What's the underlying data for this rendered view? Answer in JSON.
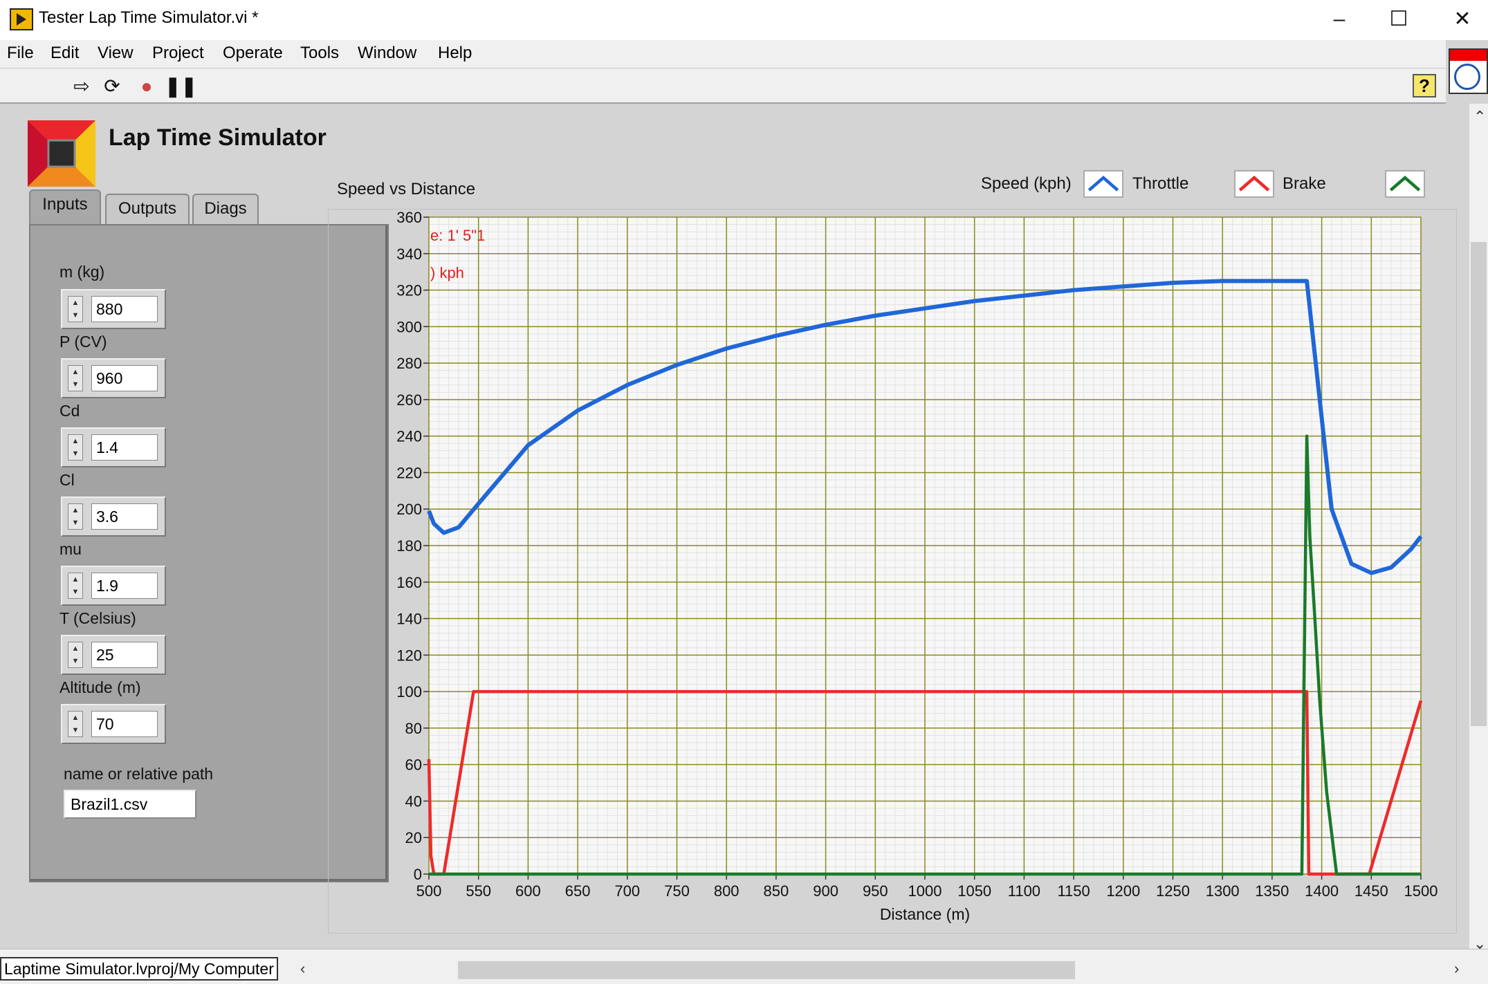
{
  "window": {
    "title": "Tester Lap Time Simulator.vi *"
  },
  "menu": [
    "File",
    "Edit",
    "View",
    "Project",
    "Operate",
    "Tools",
    "Window",
    "Help"
  ],
  "toolbar": {
    "help_label": "?"
  },
  "app": {
    "title": "Lap Time Simulator"
  },
  "tabs": [
    "Inputs",
    "Outputs",
    "Diags"
  ],
  "inputs": [
    {
      "label": "m (kg)",
      "value": "880"
    },
    {
      "label": "P (CV)",
      "value": "960"
    },
    {
      "label": "Cd",
      "value": "1.4"
    },
    {
      "label": "Cl",
      "value": "3.6"
    },
    {
      "label": "mu",
      "value": "1.9"
    },
    {
      "label": "T (Celsius)",
      "value": "25"
    },
    {
      "label": "Altitude (m)",
      "value": "70"
    }
  ],
  "file": {
    "label": "name or relative path",
    "value": "Brazil1.csv"
  },
  "status": {
    "path": "Laptime Simulator.lvproj/My Computer"
  },
  "chart_data": {
    "type": "line",
    "title": "Speed vs Distance",
    "xlabel": "Distance (m)",
    "ylabel": "",
    "xlim": [
      500,
      1500
    ],
    "ylim": [
      0,
      360
    ],
    "xticks": [
      500,
      550,
      600,
      650,
      700,
      750,
      800,
      850,
      900,
      950,
      1000,
      1050,
      1100,
      1150,
      1200,
      1250,
      1300,
      1350,
      1400,
      1450,
      1500
    ],
    "yticks": [
      0,
      20,
      40,
      60,
      80,
      100,
      120,
      140,
      160,
      180,
      200,
      220,
      240,
      260,
      280,
      300,
      320,
      340,
      360
    ],
    "grid": true,
    "legend_position": "top-right",
    "annotations": [
      "e: 1' 5\"1",
      ") kph"
    ],
    "series": [
      {
        "name": "Speed (kph)",
        "color": "#1f67d8",
        "x": [
          500,
          505,
          515,
          530,
          550,
          600,
          650,
          700,
          750,
          800,
          850,
          900,
          950,
          1000,
          1050,
          1100,
          1150,
          1200,
          1250,
          1300,
          1350,
          1385,
          1395,
          1410,
          1430,
          1450,
          1470,
          1490,
          1500
        ],
        "y": [
          199,
          192,
          187,
          190,
          203,
          235,
          254,
          268,
          279,
          288,
          295,
          301,
          306,
          310,
          314,
          317,
          320,
          322,
          324,
          325,
          325,
          325,
          275,
          200,
          170,
          165,
          168,
          178,
          185
        ]
      },
      {
        "name": "Throttle",
        "color": "#ee2a2a",
        "x": [
          500,
          502,
          505,
          515,
          545,
          1385,
          1387,
          1448,
          1500
        ],
        "y": [
          63,
          10,
          0,
          0,
          100,
          100,
          0,
          0,
          95
        ]
      },
      {
        "name": "Brake",
        "color": "#1a7a2a",
        "x": [
          500,
          1380,
          1385,
          1388,
          1392,
          1398,
          1405,
          1415,
          1500
        ],
        "y": [
          0,
          0,
          240,
          185,
          150,
          95,
          45,
          0,
          0
        ]
      }
    ]
  }
}
